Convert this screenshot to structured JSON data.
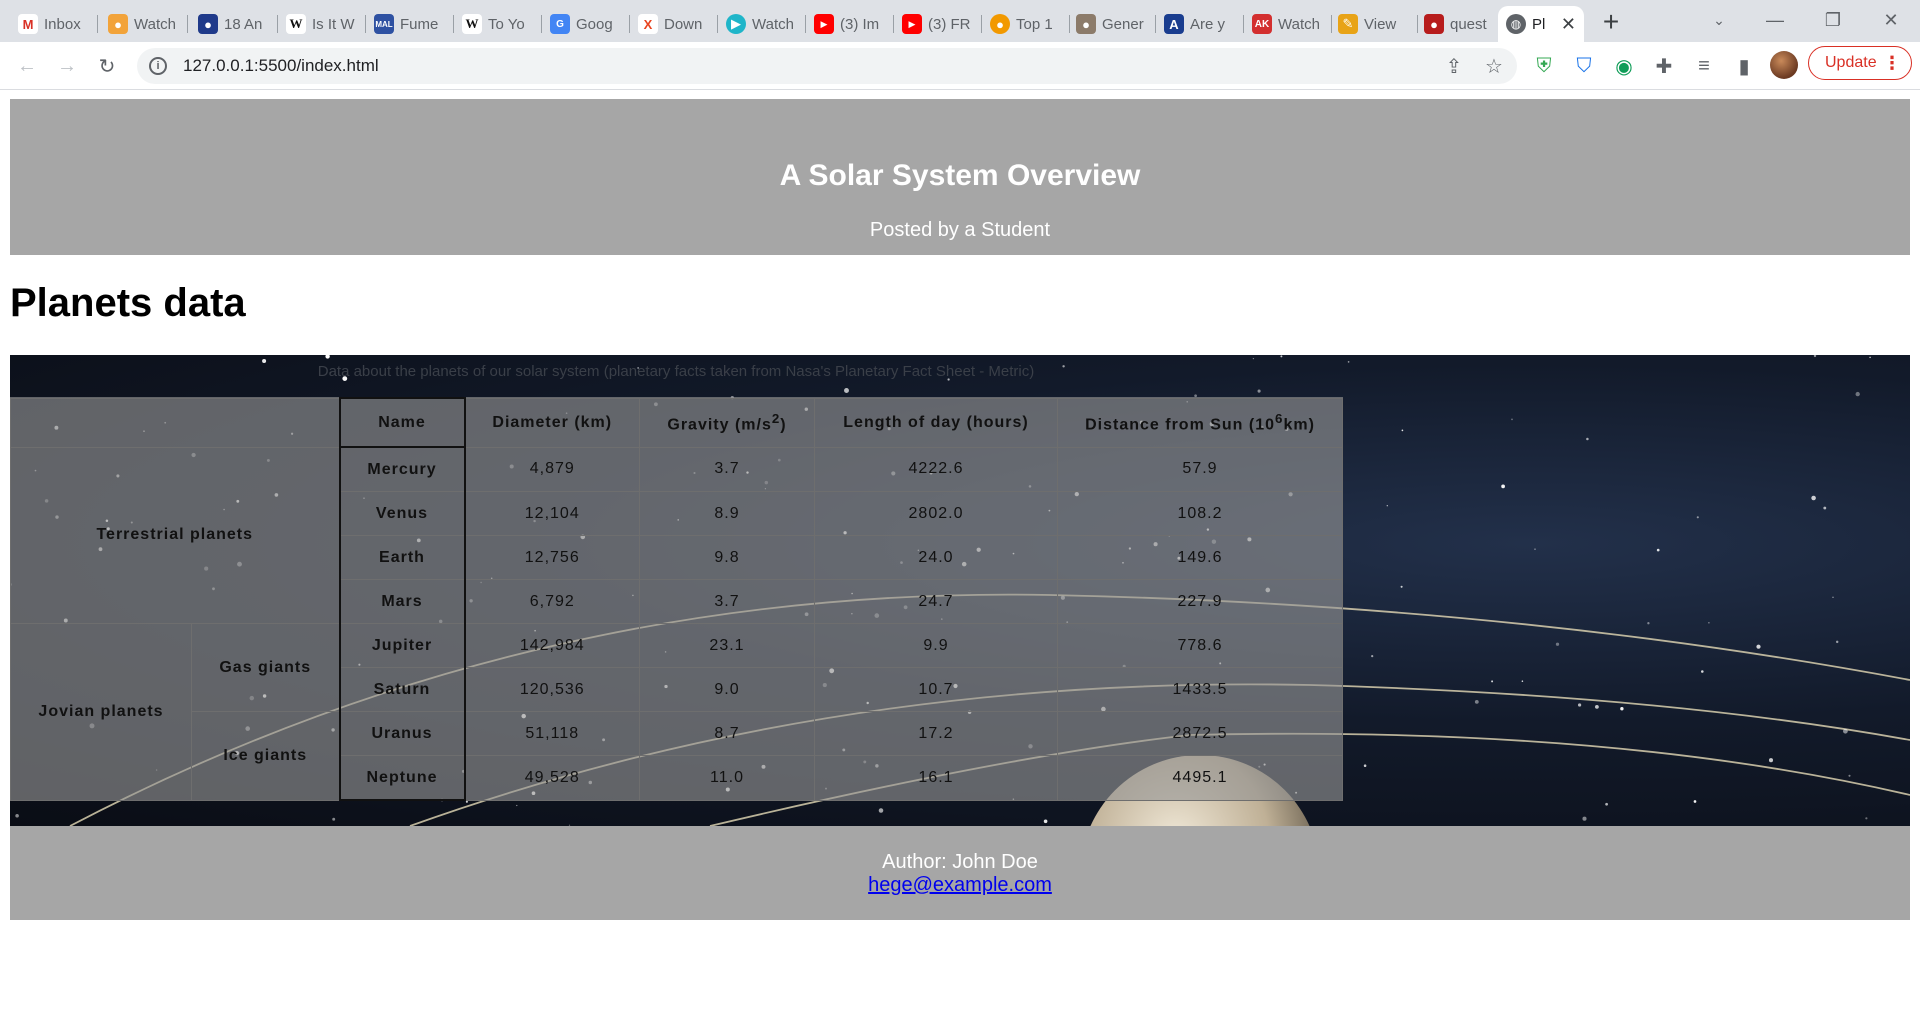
{
  "browser": {
    "tabs": [
      {
        "title": "Inbox",
        "icon": "gmail-icon",
        "color": "#ffffff"
      },
      {
        "title": "Watch",
        "icon": "app-icon",
        "color": "#f2a33a"
      },
      {
        "title": "18 An",
        "icon": "app-icon",
        "color": "#1f3a8a"
      },
      {
        "title": "Is It W",
        "icon": "wikipedia-icon",
        "color": "#ffffff"
      },
      {
        "title": "Fume",
        "icon": "mal-icon",
        "color": "#2e51a2"
      },
      {
        "title": "To Yo",
        "icon": "wikipedia-icon",
        "color": "#ffffff"
      },
      {
        "title": "Goog",
        "icon": "google-translate-icon",
        "color": "#4285f4"
      },
      {
        "title": "Down",
        "icon": "x-icon",
        "color": "#ffffff"
      },
      {
        "title": "Watch",
        "icon": "play-icon",
        "color": "#1fb5c9"
      },
      {
        "title": "(3) Im",
        "icon": "youtube-icon",
        "color": "#ff0000"
      },
      {
        "title": "(3) FR",
        "icon": "youtube-icon",
        "color": "#ff0000"
      },
      {
        "title": "Top 1",
        "icon": "app-icon",
        "color": "#f29900"
      },
      {
        "title": "Gener",
        "icon": "app-icon",
        "color": "#8c7b6a"
      },
      {
        "title": "Are y",
        "icon": "app-icon",
        "color": "#1a3d8f"
      },
      {
        "title": "Watch",
        "icon": "app-icon",
        "color": "#d32f2f"
      },
      {
        "title": "View",
        "icon": "app-icon",
        "color": "#e8a317"
      },
      {
        "title": "quest",
        "icon": "app-icon",
        "color": "#b71c1c"
      },
      {
        "title": "Pl",
        "icon": "globe-icon",
        "color": "#5f6368"
      }
    ],
    "url": "127.0.0.1:5500/index.html",
    "update_label": "Update"
  },
  "header": {
    "title": "A Solar System Overview",
    "subtitle": "Posted by a Student"
  },
  "section_heading": "Planets data",
  "table": {
    "caption": "Data about the planets of our solar system (planetary facts taken from Nasa's Planetary Fact Sheet - Metric)",
    "columns": [
      "Name",
      "Diameter (km)",
      "Gravity (m/s",
      "Length of day (hours)",
      "Distance from Sun (10"
    ],
    "gravity_sup": "2",
    "gravity_suffix": ")",
    "distance_sup": "6",
    "distance_suffix": "km)",
    "groups": {
      "terrestrial": "Terrestrial planets",
      "jovian": "Jovian planets",
      "gas": "Gas giants",
      "ice": "Ice giants"
    },
    "rows": [
      {
        "name": "Mercury",
        "diameter": "4,879",
        "gravity": "3.7",
        "day": "4222.6",
        "distance": "57.9"
      },
      {
        "name": "Venus",
        "diameter": "12,104",
        "gravity": "8.9",
        "day": "2802.0",
        "distance": "108.2"
      },
      {
        "name": "Earth",
        "diameter": "12,756",
        "gravity": "9.8",
        "day": "24.0",
        "distance": "149.6"
      },
      {
        "name": "Mars",
        "diameter": "6,792",
        "gravity": "3.7",
        "day": "24.7",
        "distance": "227.9"
      },
      {
        "name": "Jupiter",
        "diameter": "142,984",
        "gravity": "23.1",
        "day": "9.9",
        "distance": "778.6"
      },
      {
        "name": "Saturn",
        "diameter": "120,536",
        "gravity": "9.0",
        "day": "10.7",
        "distance": "1433.5"
      },
      {
        "name": "Uranus",
        "diameter": "51,118",
        "gravity": "8.7",
        "day": "17.2",
        "distance": "2872.5"
      },
      {
        "name": "Neptune",
        "diameter": "49,528",
        "gravity": "11.0",
        "day": "16.1",
        "distance": "4495.1"
      }
    ]
  },
  "footer": {
    "author": "Author: John Doe",
    "email": "hege@example.com"
  }
}
